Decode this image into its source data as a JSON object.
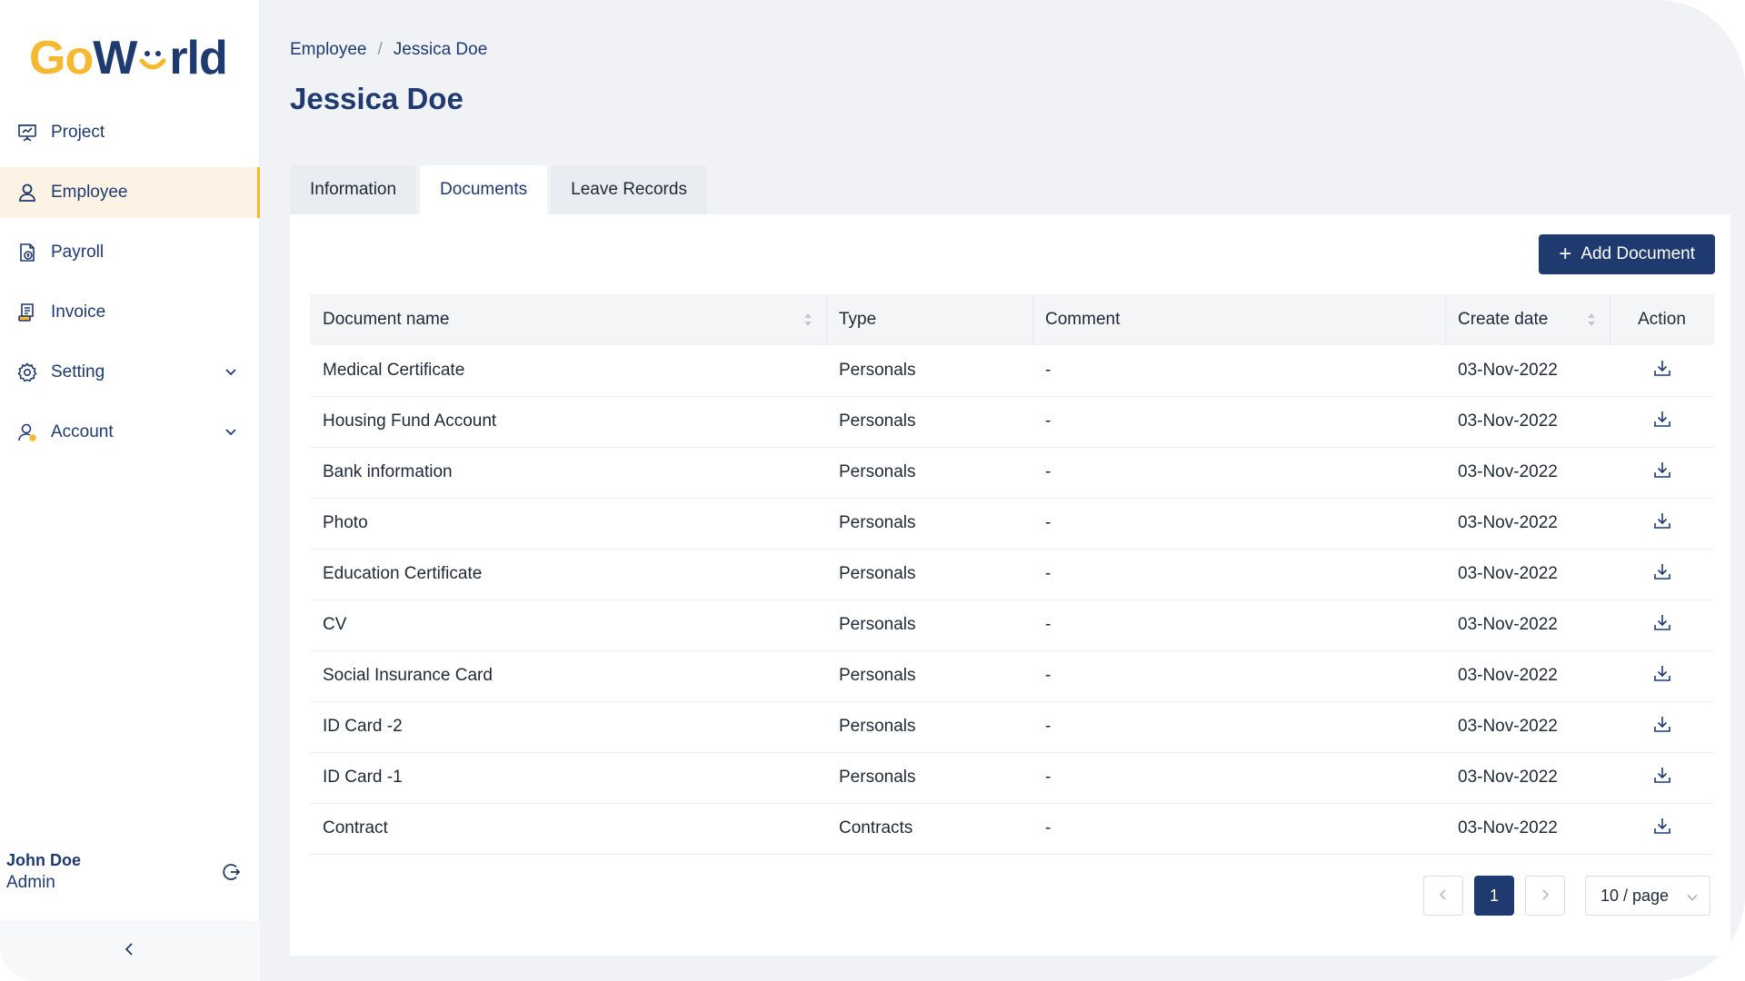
{
  "brand": {
    "logo_part1": "Go",
    "logo_part2": "W",
    "logo_part3": "rld"
  },
  "colors": {
    "primary": "#1e3a6e",
    "accent": "#f5b82e",
    "active_nav_bg": "#fdf3e4"
  },
  "sidebar": {
    "items": [
      {
        "label": "Project",
        "icon": "presentation-board-icon"
      },
      {
        "label": "Employee",
        "icon": "user-icon",
        "active": true
      },
      {
        "label": "Payroll",
        "icon": "payroll-document-icon"
      },
      {
        "label": "Invoice",
        "icon": "invoice-icon"
      },
      {
        "label": "Setting",
        "icon": "gear-icon",
        "expandable": true
      },
      {
        "label": "Account",
        "icon": "account-icon",
        "expandable": true
      }
    ],
    "user": {
      "name": "John Doe",
      "role": "Admin"
    }
  },
  "breadcrumb": {
    "parent": "Employee",
    "separator": "/",
    "current": "Jessica Doe"
  },
  "page_title": "Jessica Doe",
  "tabs": [
    {
      "label": "Information"
    },
    {
      "label": "Documents",
      "active": true
    },
    {
      "label": "Leave Records"
    }
  ],
  "toolbar": {
    "add_plus": "+",
    "add_label": "Add Document"
  },
  "table": {
    "columns": [
      "Document name",
      "Type",
      "Comment",
      "Create date",
      "Action"
    ],
    "rows": [
      {
        "name": "Medical Certificate",
        "type": "Personals",
        "comment": "-",
        "date": "03-Nov-2022"
      },
      {
        "name": "Housing Fund Account",
        "type": "Personals",
        "comment": "-",
        "date": "03-Nov-2022"
      },
      {
        "name": "Bank information",
        "type": "Personals",
        "comment": "-",
        "date": "03-Nov-2022"
      },
      {
        "name": "Photo",
        "type": "Personals",
        "comment": "-",
        "date": "03-Nov-2022"
      },
      {
        "name": "Education Certificate",
        "type": "Personals",
        "comment": "-",
        "date": "03-Nov-2022"
      },
      {
        "name": "CV",
        "type": "Personals",
        "comment": "-",
        "date": "03-Nov-2022"
      },
      {
        "name": "Social Insurance Card",
        "type": "Personals",
        "comment": "-",
        "date": "03-Nov-2022"
      },
      {
        "name": "ID Card -2",
        "type": "Personals",
        "comment": "-",
        "date": "03-Nov-2022"
      },
      {
        "name": "ID Card -1",
        "type": "Personals",
        "comment": "-",
        "date": "03-Nov-2022"
      },
      {
        "name": "Contract",
        "type": "Contracts",
        "comment": "-",
        "date": "03-Nov-2022"
      }
    ]
  },
  "pagination": {
    "prev": "<",
    "current_page": "1",
    "next": ">",
    "page_size": "10 / page"
  }
}
